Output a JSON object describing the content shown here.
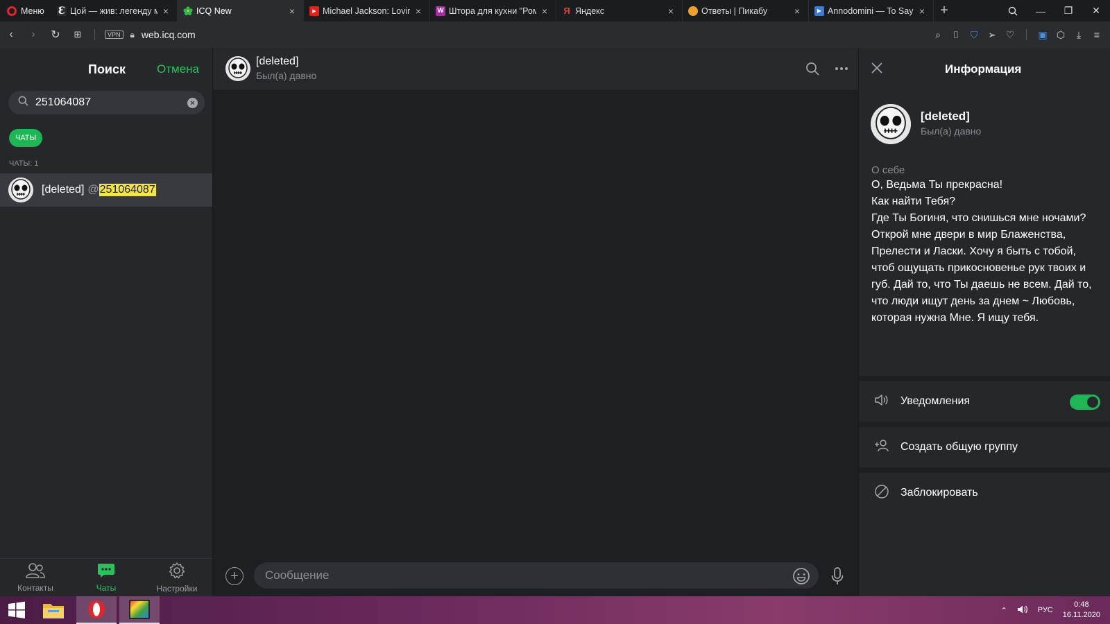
{
  "browser": {
    "menu_label": "Меню",
    "tabs": [
      {
        "title": "Цой — жив: легенду му",
        "icon": "e-icon",
        "color": "#2b2c30"
      },
      {
        "title": "ICQ New",
        "icon": "icq-flower-icon",
        "color": "#2bbd4f",
        "active": true
      },
      {
        "title": "Michael Jackson: Loving",
        "icon": "youtube-icon",
        "color": "#e62117"
      },
      {
        "title": "Штора для кухни \"Роме",
        "icon": "wildberries-icon",
        "color": "#a82ca5"
      },
      {
        "title": "Яндекс",
        "icon": "yandex-icon",
        "color": "#f33"
      },
      {
        "title": "Ответы | Пикабу",
        "icon": "pikabu-icon",
        "color": "#f0a030"
      },
      {
        "title": "Annodomini — To Say G",
        "icon": "vk-video-icon",
        "color": "#3a7bd5"
      }
    ],
    "url": "web.icq.com",
    "vpn_label": "VPN"
  },
  "left_panel": {
    "title": "Поиск",
    "cancel_label": "Отмена",
    "search_value": "251064087",
    "filter_chip": "ЧАТЫ",
    "chats_count_label": "ЧАТЫ: 1",
    "result": {
      "name": "[deleted]",
      "at": "@",
      "highlight": "251064087"
    },
    "nav": {
      "contacts": "Контакты",
      "chats": "Чаты",
      "settings": "Настройки"
    }
  },
  "chat": {
    "name": "[deleted]",
    "status": "Был(а) давно",
    "input_placeholder": "Сообщение"
  },
  "info_panel": {
    "title": "Информация",
    "name": "[deleted]",
    "status": "Был(а) давно",
    "about_label": "О себе",
    "about_text": "О, Ведьма Ты прекрасна!\nКак найти Тебя?\nГде Ты Богиня, что снишься мне ночами?\nОткрой мне двери в мир Блаженства, Прелести и Ласки. Хочу я быть с тобой, чтоб ощущать прикосновенье рук твоих и губ. Дай то, что Ты даешь не всем. Дай то, что люди ищут день за днем ~ Любовь, которая нужна Мне. Я ищу тебя.",
    "notifications_label": "Уведомления",
    "notifications_on": true,
    "create_group_label": "Создать общую группу",
    "block_label": "Заблокировать"
  },
  "taskbar": {
    "lang": "РУС",
    "time": "0:48",
    "date": "16.11.2020"
  },
  "colors": {
    "accent_green": "#2ac15b",
    "highlight_yellow": "#f3e44d"
  }
}
